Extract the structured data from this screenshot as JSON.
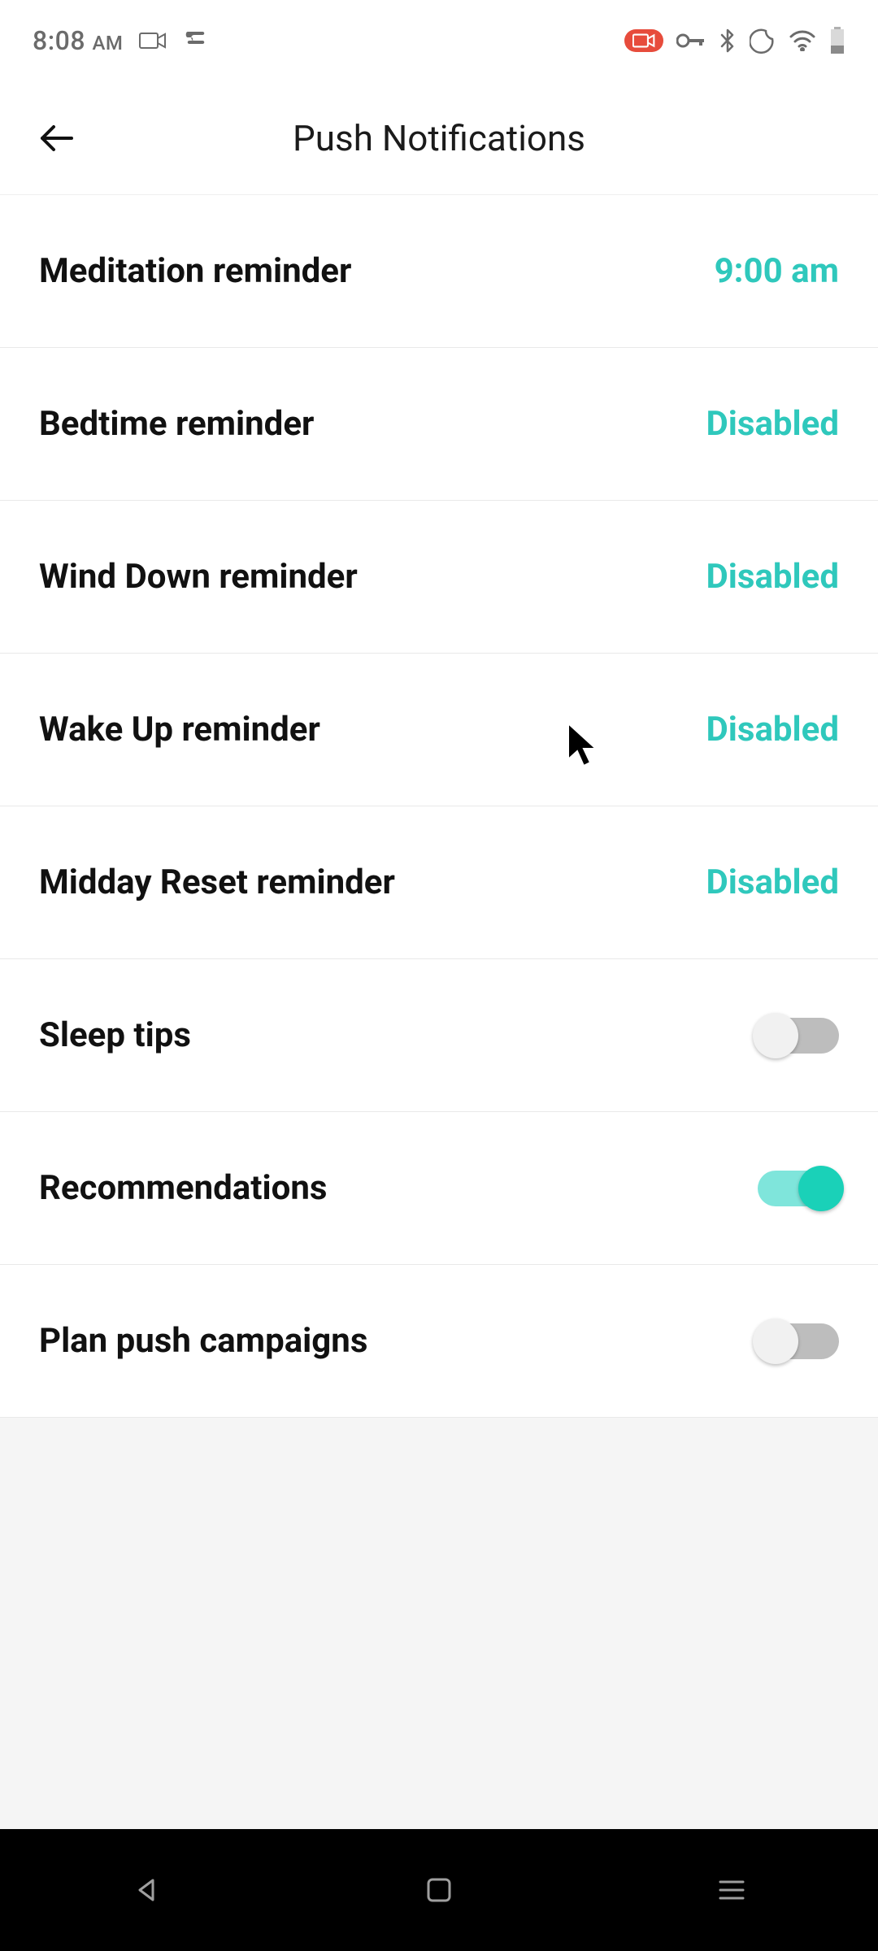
{
  "status": {
    "time": "8:08",
    "ampm": "AM"
  },
  "header": {
    "title": "Push Notifications"
  },
  "rows": [
    {
      "label": "Meditation reminder",
      "value": "9:00 am"
    },
    {
      "label": "Bedtime reminder",
      "value": "Disabled"
    },
    {
      "label": "Wind Down reminder",
      "value": "Disabled"
    },
    {
      "label": "Wake Up reminder",
      "value": "Disabled"
    },
    {
      "label": "Midday Reset reminder",
      "value": "Disabled"
    },
    {
      "label": "Sleep tips",
      "toggle": false
    },
    {
      "label": "Recommendations",
      "toggle": true
    },
    {
      "label": "Plan push campaigns",
      "toggle": false
    }
  ],
  "colors": {
    "accent": "#2fc8bc"
  }
}
